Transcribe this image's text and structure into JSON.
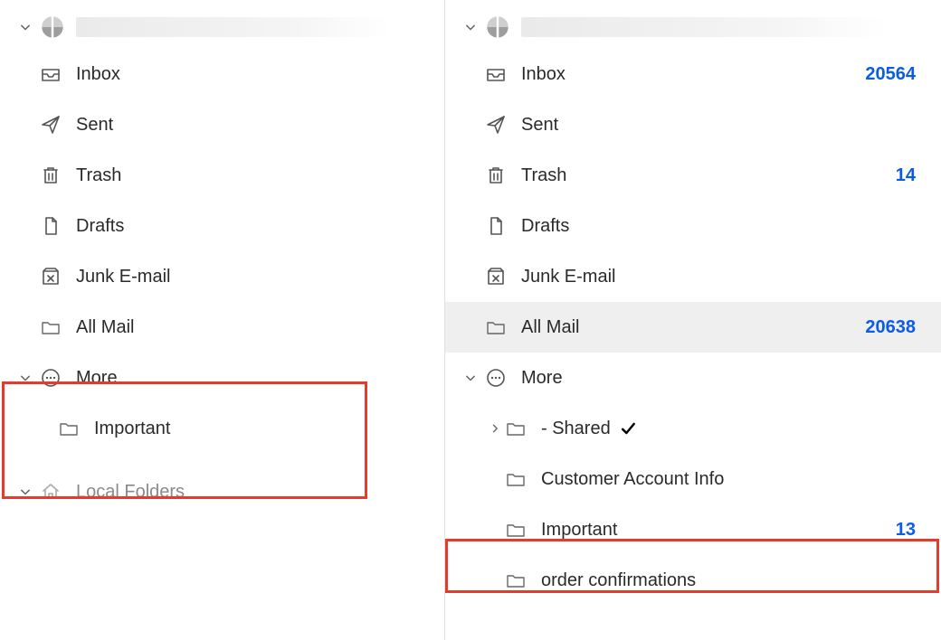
{
  "left": {
    "folders": {
      "inbox": "Inbox",
      "sent": "Sent",
      "trash": "Trash",
      "drafts": "Drafts",
      "junk": "Junk E-mail",
      "allmail": "All Mail",
      "more": "More",
      "important": "Important"
    },
    "localFolders": "Local Folders"
  },
  "right": {
    "folders": {
      "inbox": "Inbox",
      "sent": "Sent",
      "trash": "Trash",
      "drafts": "Drafts",
      "junk": "Junk E-mail",
      "allmail": "All Mail",
      "more": "More",
      "shared": " - Shared",
      "customer": "Customer Account Info",
      "important": "Important",
      "orderconf": "order confirmations"
    },
    "counts": {
      "inbox": "20564",
      "trash": "14",
      "allmail": "20638",
      "important": "13"
    }
  }
}
